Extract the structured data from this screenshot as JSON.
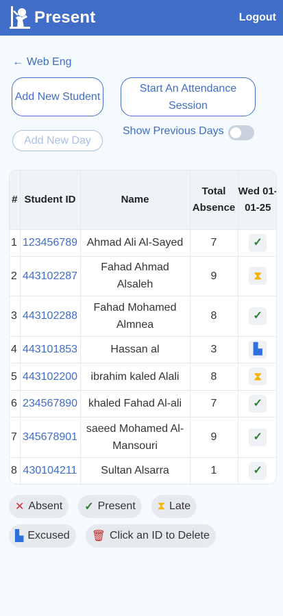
{
  "header": {
    "title": "Present",
    "logout": "Logout"
  },
  "nav": {
    "back_label": "Web Eng"
  },
  "actions": {
    "add_student": "Add New Student",
    "start_session": "Start An Attendance Session",
    "add_day": "Add New Day",
    "show_previous": "Show Previous Days"
  },
  "table": {
    "headers": {
      "index": "#",
      "student_id": "Student ID",
      "name": "Name",
      "total": "Total Absence",
      "day": "Wed 01-01-25"
    },
    "rows": [
      {
        "idx": "1",
        "id": "123456789",
        "name": "Ahmad Ali Al-Sayed",
        "total": "7",
        "status": "present"
      },
      {
        "idx": "2",
        "id": "443102287",
        "name": "Fahad Ahmad Alsaleh",
        "total": "9",
        "status": "late"
      },
      {
        "idx": "3",
        "id": "443102288",
        "name": "Fahad Mohamed Almnea",
        "total": "8",
        "status": "present"
      },
      {
        "idx": "4",
        "id": "443101853",
        "name": "Hassan al",
        "total": "3",
        "status": "excused"
      },
      {
        "idx": "5",
        "id": "443102200",
        "name": "ibrahim kaled Alali",
        "total": "8",
        "status": "late"
      },
      {
        "idx": "6",
        "id": "234567890",
        "name": "khaled Fahad Al-ali",
        "total": "7",
        "status": "present"
      },
      {
        "idx": "7",
        "id": "345678901",
        "name": "saeed Mohamed Al-Mansouri",
        "total": "9",
        "status": "present"
      },
      {
        "idx": "8",
        "id": "430104211",
        "name": "Sultan Alsarra",
        "total": "1",
        "status": "present"
      }
    ]
  },
  "legend": {
    "absent": "Absent",
    "present": "Present",
    "late": "Late",
    "excused": "Excused",
    "delete_hint": "Click an ID to Delete"
  },
  "colors": {
    "primary": "#3f6dc7",
    "present": "#2e7d32",
    "late": "#f5b400",
    "excused": "#2f6fe0",
    "absent": "#d32f2f"
  }
}
